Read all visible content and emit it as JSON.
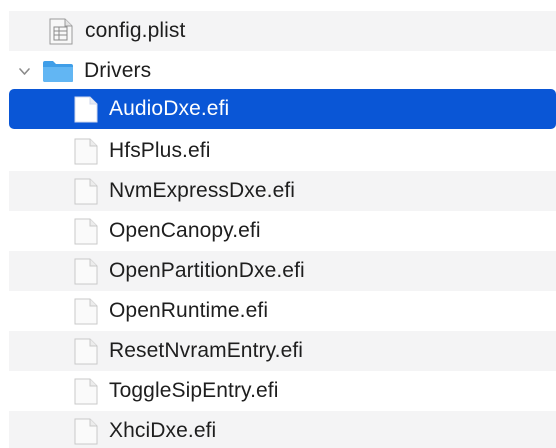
{
  "rows": [
    {
      "name": "config.plist",
      "type": "plist",
      "icon": "plist-file-icon"
    },
    {
      "name": "Drivers",
      "type": "folder",
      "expanded": true,
      "icon": "folder-icon"
    },
    {
      "name": "AudioDxe.efi",
      "type": "file",
      "selected": true,
      "icon": "document-icon"
    },
    {
      "name": "HfsPlus.efi",
      "type": "file",
      "icon": "document-icon"
    },
    {
      "name": "NvmExpressDxe.efi",
      "type": "file",
      "icon": "document-icon"
    },
    {
      "name": "OpenCanopy.efi",
      "type": "file",
      "icon": "document-icon"
    },
    {
      "name": "OpenPartitionDxe.efi",
      "type": "file",
      "icon": "document-icon"
    },
    {
      "name": "OpenRuntime.efi",
      "type": "file",
      "icon": "document-icon"
    },
    {
      "name": "ResetNvramEntry.efi",
      "type": "file",
      "icon": "document-icon"
    },
    {
      "name": "ToggleSipEntry.efi",
      "type": "file",
      "icon": "document-icon"
    },
    {
      "name": "XhciDxe.efi",
      "type": "file",
      "icon": "document-icon"
    }
  ],
  "colors": {
    "selection": "#0a56d6",
    "stripe": "#f4f4f5",
    "folder": "#4aa9ef",
    "text": "#1e1e1e"
  }
}
